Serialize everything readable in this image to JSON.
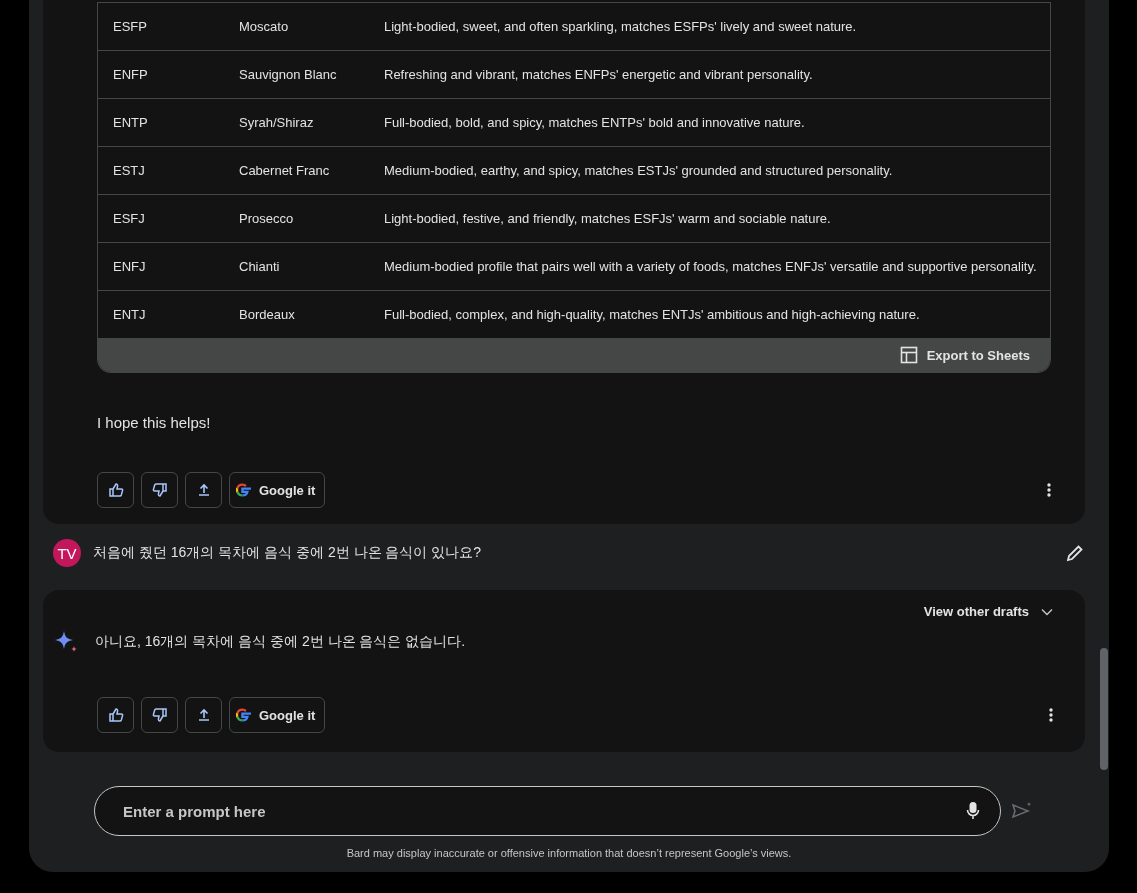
{
  "table": {
    "rows": [
      {
        "cells": [
          "ESFP",
          "Moscato",
          "Light-bodied, sweet, and often sparkling, matches ESFPs' lively and sweet nature."
        ]
      },
      {
        "cells": [
          "ENFP",
          "Sauvignon Blanc",
          "Refreshing and vibrant, matches ENFPs' energetic and vibrant personality."
        ]
      },
      {
        "cells": [
          "ENTP",
          "Syrah/Shiraz",
          "Full-bodied, bold, and spicy, matches ENTPs' bold and innovative nature."
        ]
      },
      {
        "cells": [
          "ESTJ",
          "Cabernet Franc",
          "Medium-bodied, earthy, and spicy, matches ESTJs' grounded and structured personality."
        ]
      },
      {
        "cells": [
          "ESFJ",
          "Prosecco",
          "Light-bodied, festive, and friendly, matches ESFJs' warm and sociable nature."
        ]
      },
      {
        "cells": [
          "ENFJ",
          "Chianti",
          "Medium-bodied profile that pairs well with a variety of foods, matches ENFJs' versatile and supportive personality."
        ]
      },
      {
        "cells": [
          "ENTJ",
          "Bordeaux",
          "Full-bodied, complex, and high-quality, matches ENTJs' ambitious and high-achieving nature."
        ]
      }
    ],
    "export_label": "Export to Sheets"
  },
  "first_reply": {
    "text": "I hope this helps!",
    "google_label": "Google it"
  },
  "user_message": {
    "avatar": "TV",
    "text": "처음에 줬던 16개의 목차에 음식 중에 2번 나온 음식이 있나요?"
  },
  "second_reply": {
    "drafts_label": "View other drafts",
    "text": "아니요, 16개의 목차에 음식 중에 2번 나온 음식은 없습니다.",
    "google_label": "Google it"
  },
  "prompt": {
    "placeholder": "Enter a prompt here"
  },
  "disclaimer": "Bard may display inaccurate or offensive information that doesn’t represent Google’s views."
}
